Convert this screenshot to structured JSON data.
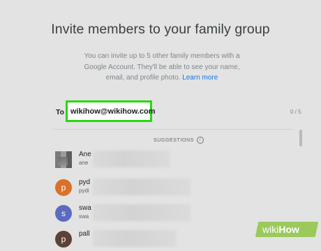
{
  "page": {
    "title": "Invite members to your family group",
    "description": "You can invite up to 5 other family members with a Google Account. They'll be able to see your name, email, and profile photo.",
    "learn_more": "Learn more"
  },
  "invite": {
    "to_label": "To",
    "email_value": "wikihow@wikihow.com",
    "count": "0 / 5"
  },
  "suggestions": {
    "label": "SUGGESTIONS",
    "items": [
      {
        "name": "Ane",
        "sub": "ane",
        "avatar": "",
        "avatar_color": "#888888",
        "avatar_type": "photo"
      },
      {
        "name": "pyd",
        "sub": "pydi",
        "avatar": "p",
        "avatar_color": "#d9712b",
        "avatar_type": "letter"
      },
      {
        "name": "swa",
        "sub": "swa",
        "avatar": "s",
        "avatar_color": "#5c6bc0",
        "avatar_type": "letter"
      },
      {
        "name": "pall",
        "sub": "",
        "avatar": "p",
        "avatar_color": "#5d4037",
        "avatar_type": "letter"
      }
    ]
  },
  "watermark": {
    "part1": "wiki",
    "part2": "How"
  },
  "colors": {
    "highlight": "#27d80e",
    "link": "#1a73e8",
    "watermark_bg": "#9bc95c"
  }
}
